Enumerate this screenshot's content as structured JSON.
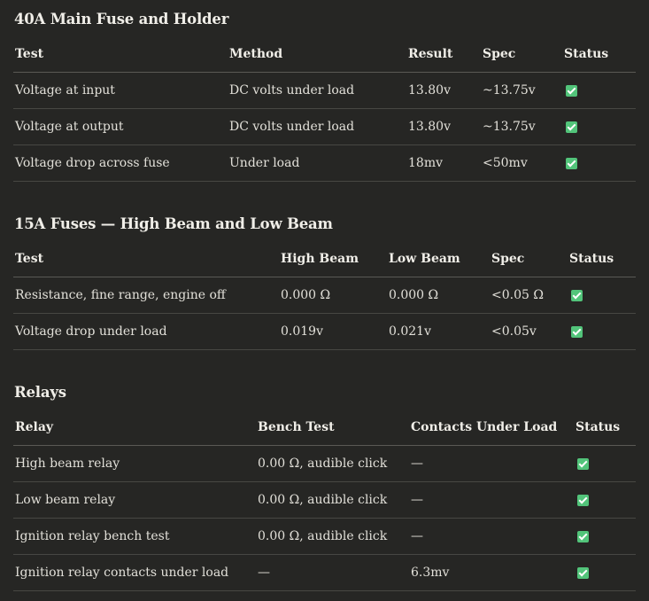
{
  "sections": [
    {
      "title": "40A Main Fuse and Holder",
      "headers": [
        "Test",
        "Method",
        "Result",
        "Spec",
        "Status"
      ],
      "rows": [
        [
          "Voltage at input",
          "DC volts under load",
          "13.80v",
          "~13.75v",
          "pass"
        ],
        [
          "Voltage at output",
          "DC volts under load",
          "13.80v",
          "~13.75v",
          "pass"
        ],
        [
          "Voltage drop across fuse",
          "Under load",
          "18mv",
          "<50mv",
          "pass"
        ]
      ]
    },
    {
      "title": "15A Fuses — High Beam and Low Beam",
      "headers": [
        "Test",
        "High Beam",
        "Low Beam",
        "Spec",
        "Status"
      ],
      "rows": [
        [
          "Resistance, fine range, engine off",
          "0.000 Ω",
          "0.000 Ω",
          "<0.05 Ω",
          "pass"
        ],
        [
          "Voltage drop under load",
          "0.019v",
          "0.021v",
          "<0.05v",
          "pass"
        ]
      ]
    },
    {
      "title": "Relays",
      "headers": [
        "Relay",
        "Bench Test",
        "Contacts Under Load",
        "Status"
      ],
      "rows": [
        [
          "High beam relay",
          "0.00 Ω, audible click",
          "—",
          "pass"
        ],
        [
          "Low beam relay",
          "0.00 Ω, audible click",
          "—",
          "pass"
        ],
        [
          "Ignition relay bench test",
          "0.00 Ω, audible click",
          "—",
          "pass"
        ],
        [
          "Ignition relay contacts under load",
          "—",
          "6.3mv",
          "pass"
        ]
      ]
    }
  ],
  "status_icon": "check-box-icon",
  "colors": {
    "background": "#262624",
    "text": "#e8e6df",
    "pass": "#52c47a",
    "divider": "#474743"
  }
}
